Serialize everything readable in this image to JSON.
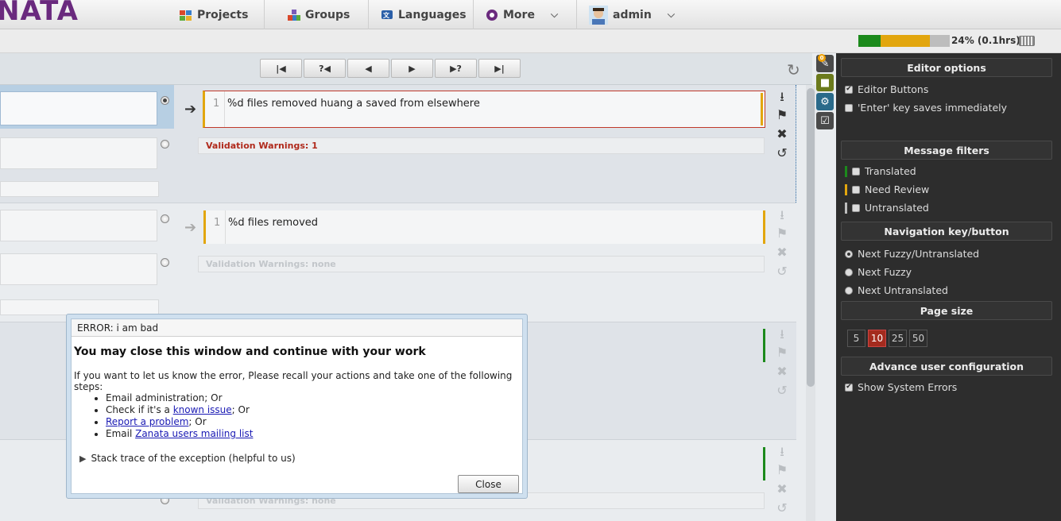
{
  "header": {
    "logo": "NATA",
    "nav": [
      {
        "label": "Projects",
        "icon": "projects-icon"
      },
      {
        "label": "Groups",
        "icon": "groups-icon"
      },
      {
        "label": "Languages",
        "icon": "languages-icon"
      },
      {
        "label": "More",
        "icon": "more-icon"
      },
      {
        "label": "admin",
        "icon": "avatar-icon"
      }
    ]
  },
  "progress": {
    "label": "24% (0.1hrs)",
    "translated_pct": 24,
    "need_review_pct": 54,
    "colors": {
      "translated": "#1c8a1c",
      "need_review": "#e2a60e",
      "untranslated": "#bdbdbd"
    }
  },
  "toolbar": {
    "buttons": [
      {
        "label": "|◀",
        "name": "first-entry-button"
      },
      {
        "label": "?◀",
        "name": "prev-fuzzy-button"
      },
      {
        "label": "◀",
        "name": "prev-entry-button"
      },
      {
        "label": "▶",
        "name": "next-entry-button"
      },
      {
        "label": "▶?",
        "name": "next-fuzzy-button"
      },
      {
        "label": "▶|",
        "name": "last-entry-button"
      }
    ]
  },
  "rows": [
    {
      "line": "1",
      "text": "%d files removed huang a saved from elsewhere",
      "warning": "Validation Warnings: 1"
    },
    {
      "line": "1",
      "text": "%d files removed",
      "warning": "Validation Warnings: none"
    },
    {
      "line": "",
      "text": "",
      "warning": "Validation Warnings: none"
    }
  ],
  "sidetabs": {
    "badge": "0"
  },
  "options": {
    "editor_options_title": "Editor options",
    "editor_buttons": "Editor Buttons",
    "enter_saves": "'Enter' key saves immediately",
    "message_filters_title": "Message filters",
    "filters": [
      {
        "label": "Translated",
        "color": "#1c8a1c"
      },
      {
        "label": "Need Review",
        "color": "#e2a60e"
      },
      {
        "label": "Untranslated",
        "color": "#bdbdbd"
      }
    ],
    "navigation_title": "Navigation key/button",
    "nav_options": [
      "Next Fuzzy/Untranslated",
      "Next Fuzzy",
      "Next Untranslated"
    ],
    "page_size_title": "Page size",
    "page_sizes": [
      "5",
      "10",
      "25",
      "50"
    ],
    "selected_page_size": "10",
    "advance_title": "Advance user configuration",
    "show_errors": "Show System Errors"
  },
  "dialog": {
    "title": "ERROR: i am bad",
    "heading": "You may close this window and continue with your work",
    "paragraph": "If you want to let us know the error, Please recall your actions and take one of the following steps:",
    "step1": "Email administration; Or",
    "step2_pre": "Check if it's a ",
    "step2_link": "known issue",
    "step2_post": "; Or",
    "step3_link": "Report a problem",
    "step3_post": "; Or",
    "step4_pre": "Email ",
    "step4_link": "Zanata users mailing list",
    "trace": "Stack trace of the exception (helpful to us)",
    "close": "Close"
  }
}
